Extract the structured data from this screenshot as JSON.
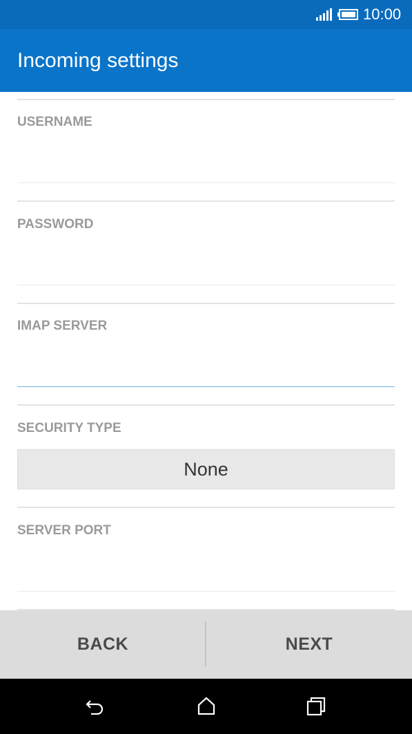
{
  "status_bar": {
    "time": "10:00",
    "icons": [
      "signal-icon",
      "battery-icon"
    ]
  },
  "app_bar": {
    "title": "Incoming settings"
  },
  "form": {
    "username": {
      "label": "USERNAME",
      "value": ""
    },
    "password": {
      "label": "PASSWORD",
      "value": ""
    },
    "imap_server": {
      "label": "IMAP SERVER",
      "value": ""
    },
    "security_type": {
      "label": "SECURITY TYPE",
      "selected": "None"
    },
    "server_port": {
      "label": "SERVER PORT",
      "value": ""
    }
  },
  "bottom_bar": {
    "back_label": "BACK",
    "next_label": "NEXT"
  },
  "nav_bar": {
    "icons": [
      "back-icon",
      "home-icon",
      "recents-icon"
    ]
  },
  "colors": {
    "status_bar": "#0a6bbd",
    "app_bar": "#0a74c9",
    "label": "#9a9a9a",
    "active_underline": "#6cb6e6"
  }
}
